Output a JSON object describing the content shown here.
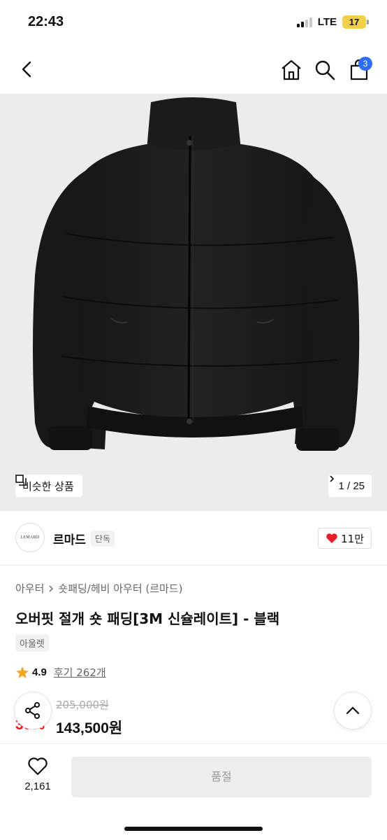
{
  "status_bar": {
    "time": "22:43",
    "network": "LTE",
    "battery": "17"
  },
  "nav": {
    "cart_count": "3",
    "icons": [
      "back-icon",
      "home-icon",
      "search-icon",
      "cart-icon"
    ]
  },
  "gallery": {
    "similar_label": "비슷한 상품",
    "counter": "1 / 25"
  },
  "brand": {
    "logo_text": "LEMARD",
    "name": "르마드",
    "tag": "단독",
    "likes": "11만"
  },
  "product": {
    "breadcrumb": [
      "아우터",
      "숏패딩/헤비 아우터 (르마드)"
    ],
    "title": "오버핏 절개 숏 패딩[3M 신슐레이트] - 블랙",
    "tag": "아울렛",
    "rating": "4.9",
    "reviews": "후기 262개",
    "original_price": "205,000원",
    "discount": "30%",
    "price": "143,500원"
  },
  "bottom": {
    "wish_count": "2,161",
    "buy_label": "품절"
  },
  "colors": {
    "accent": "#2f6df5",
    "discount": "#f31110",
    "heart": "#e8202a",
    "star": "#f5a623"
  }
}
